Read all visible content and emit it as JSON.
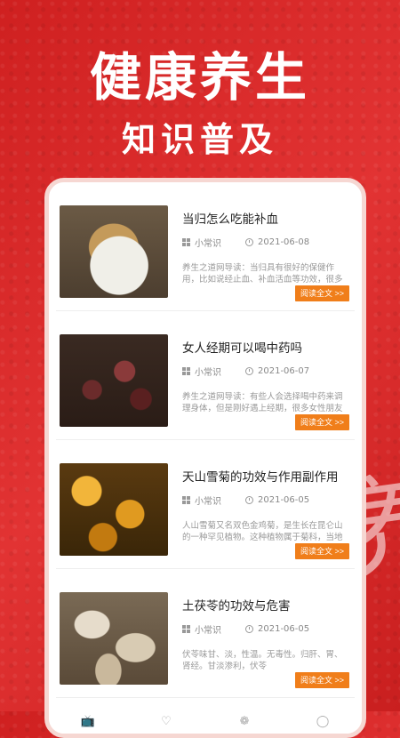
{
  "banner": {
    "title": "健康养生",
    "subtitle": "知识普及"
  },
  "articles": [
    {
      "title": "当归怎么吃能补血",
      "category": "小常识",
      "date": "2021-06-08",
      "excerpt": "养生之道网导读：当归具有很好的保健作用，比如说经止血、补血活血等功效，很多人都知道当归的...",
      "button": "阅读全文 >>"
    },
    {
      "title": "女人经期可以喝中药吗",
      "category": "小常识",
      "date": "2021-06-07",
      "excerpt": "养生之道网导读：有些人会选择喝中药来调理身体，但是刚好遇上经期，很多女性朋友都会担心...",
      "button": "阅读全文 >>"
    },
    {
      "title": "天山雪菊的功效与作用副作用",
      "category": "小常识",
      "date": "2021-06-05",
      "excerpt": "人山雪菊又名双色金鸡菊，是生长在昆仑山的一种罕见植物。这种植物属于菊科，当地居民...",
      "button": "阅读全文 >>"
    },
    {
      "title": "土茯苓的功效与危害",
      "category": "小常识",
      "date": "2021-06-05",
      "excerpt": "伏苓味甘、淡，性温。无毒性。归肝、胃、肾经。甘淡渗利，伏苓",
      "button": "阅读全文 >>"
    }
  ],
  "watermark": "养",
  "tabbar": {
    "items": [
      {
        "icon": "tv-icon"
      },
      {
        "icon": "heart-icon"
      },
      {
        "icon": "leaf-icon"
      },
      {
        "icon": "profile-icon"
      }
    ]
  },
  "colors": {
    "background": "#d92a2a",
    "accent_button": "#f07e1a",
    "active_tab": "#e02a2a"
  }
}
